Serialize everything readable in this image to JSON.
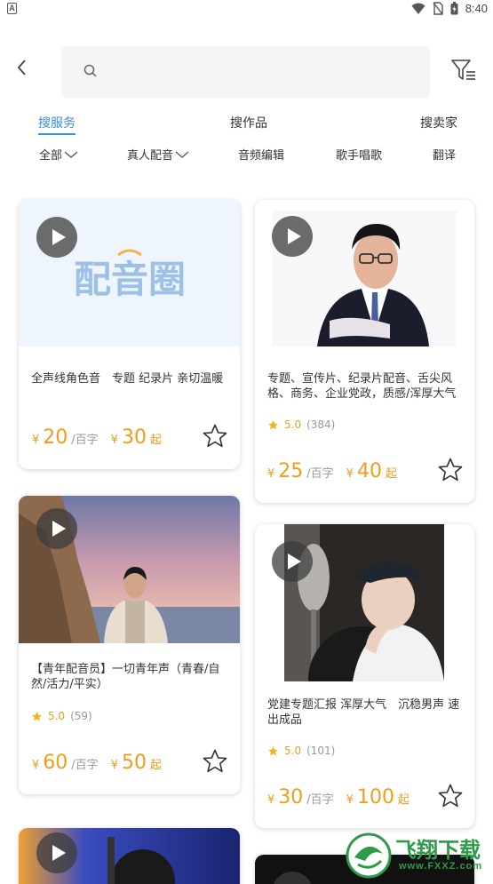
{
  "status_bar": {
    "app_indicator": "A",
    "time": "8:40"
  },
  "search": {
    "placeholder": "",
    "value": ""
  },
  "tabs": [
    {
      "label": "搜服务",
      "active": true
    },
    {
      "label": "搜作品",
      "active": false
    },
    {
      "label": "搜卖家",
      "active": false
    }
  ],
  "categories": [
    {
      "label": "全部",
      "has_dropdown": true
    },
    {
      "label": "真人配音",
      "has_dropdown": true
    },
    {
      "label": "音频编辑",
      "has_dropdown": false
    },
    {
      "label": "歌手唱歌",
      "has_dropdown": false
    },
    {
      "label": "翻译",
      "has_dropdown": false
    }
  ],
  "cards": [
    {
      "thumb_logo_text": "配音圈",
      "description": "全声线角色音　专题 纪录片 亲切温暖",
      "price_per_100": "20",
      "price_unit": "/百字",
      "price_min": "30",
      "price_min_suffix": "起",
      "currency": "¥"
    },
    {
      "description": "专题、宣传片、纪录片配音、舌尖风格、商务、企业党政，质感/浑厚大气",
      "rating": "5.0",
      "reviews": "(384)",
      "price_per_100": "25",
      "price_unit": "/百字",
      "price_min": "40",
      "price_min_suffix": "起",
      "currency": "¥"
    },
    {
      "description": "【青年配音员】一切青年声（青春/自然/活力/平实）",
      "rating": "5.0",
      "reviews": "(59)",
      "price_per_100": "60",
      "price_unit": "/百字",
      "price_min": "50",
      "price_min_suffix": "起",
      "currency": "¥"
    },
    {
      "description": "党建专题汇报 浑厚大气　沉稳男声 速出成品",
      "rating": "5.0",
      "reviews": "(101)",
      "price_per_100": "30",
      "price_unit": "/百字",
      "price_min": "100",
      "price_min_suffix": "起",
      "currency": "¥"
    }
  ],
  "watermark": {
    "cn": "飞翔下载",
    "url": "www.FXXZ.com"
  },
  "colors": {
    "accent": "#3a8fdc",
    "price": "#f39b1c",
    "rating": "#e8a020"
  }
}
